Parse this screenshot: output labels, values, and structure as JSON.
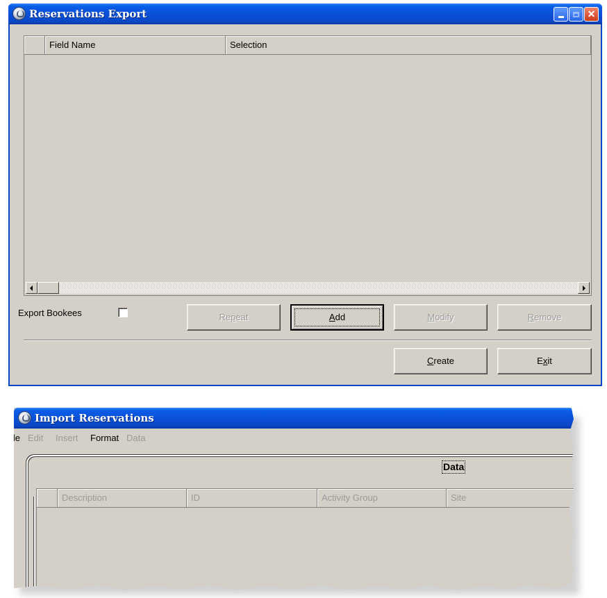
{
  "export_window": {
    "title": "Reservations Export",
    "grid": {
      "columns": [
        "Field Name",
        "Selection"
      ]
    },
    "export_bookees_label": "Export Bookees",
    "export_bookees_checked": false,
    "buttons": {
      "repeat": {
        "pre": "Re",
        "u": "p",
        "post": "eat"
      },
      "add": {
        "pre": "",
        "u": "A",
        "post": "dd"
      },
      "modify": {
        "pre": "",
        "u": "M",
        "post": "odify"
      },
      "remove": {
        "pre": "",
        "u": "R",
        "post": "emove"
      },
      "create": {
        "pre": "",
        "u": "C",
        "post": "reate"
      },
      "exit": {
        "pre": "E",
        "u": "x",
        "post": "it"
      }
    }
  },
  "import_window": {
    "title": "Import Reservations",
    "menu": [
      {
        "label": "File",
        "enabled": true
      },
      {
        "label": "Edit",
        "enabled": false
      },
      {
        "label": "Insert",
        "enabled": false
      },
      {
        "label": "Format",
        "enabled": true
      },
      {
        "label": "Data",
        "enabled": false
      }
    ],
    "tab_label": "Data",
    "grid": {
      "columns": [
        "Description",
        "ID",
        "Activity Group",
        "Site"
      ]
    }
  },
  "colors": {
    "title_bar": "#0a4fd6",
    "face": "#d4d0c8",
    "close_button": "#c93b18"
  }
}
